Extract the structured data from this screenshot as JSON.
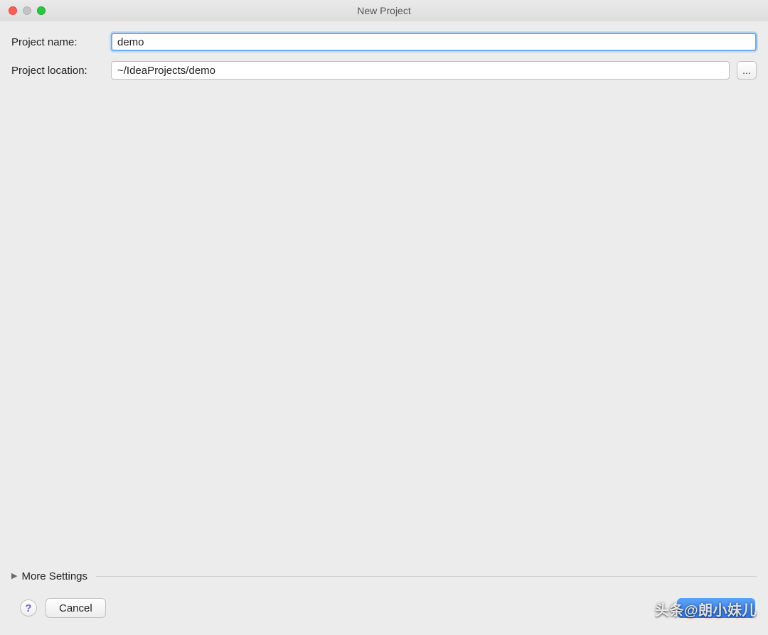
{
  "window": {
    "title": "New Project"
  },
  "form": {
    "project_name_label": "Project name:",
    "project_name_value": "demo",
    "project_location_label": "Project location:",
    "project_location_value": "~/IdeaProjects/demo",
    "browse_label": "..."
  },
  "more_settings": {
    "label": "More Settings"
  },
  "footer": {
    "help_label": "?",
    "cancel_label": "Cancel"
  },
  "watermark": "头条@朗小妹儿"
}
